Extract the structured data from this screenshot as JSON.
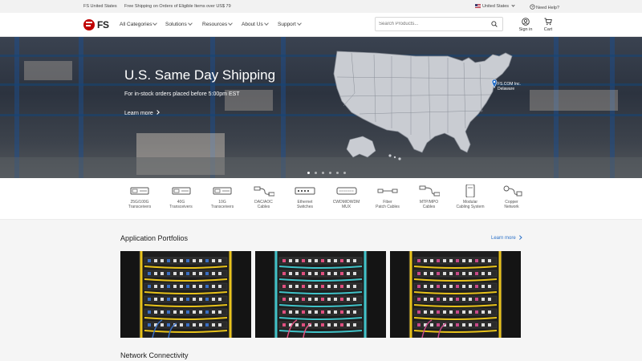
{
  "topbar": {
    "site": "FS United States",
    "promo": "Free Shipping on Orders of Eligible Items over US$ 79",
    "region": "United States",
    "help": "Need Help?"
  },
  "header": {
    "logo_text": "FS",
    "nav": [
      "All Categories",
      "Solutions",
      "Resources",
      "About Us",
      "Support"
    ],
    "search_placeholder": "Search Products...",
    "sign_in": "Sign in",
    "cart": "Cart"
  },
  "hero": {
    "title": "U.S. Same Day Shipping",
    "subtitle": "For in-stock orders placed before 5:00pm EST",
    "link": "Learn more",
    "pin_name": "FS.COM Inc.",
    "pin_place": "Delaware",
    "slides": 6,
    "active_slide": 0
  },
  "categories": [
    {
      "label": "25G/100G\nTransceivers",
      "icon": "transceiver-icon"
    },
    {
      "label": "40G\nTransceivers",
      "icon": "transceiver-icon"
    },
    {
      "label": "10G\nTransceivers",
      "icon": "transceiver-icon"
    },
    {
      "label": "DAC/AOC\nCables",
      "icon": "dac-cable-icon"
    },
    {
      "label": "Ethernet\nSwitches",
      "icon": "switch-icon"
    },
    {
      "label": "CWDM/DWDM\nMUX",
      "icon": "mux-icon"
    },
    {
      "label": "Fiber\nPatch Cables",
      "icon": "patch-cable-icon"
    },
    {
      "label": "MTP/MPO\nCables",
      "icon": "mtp-cable-icon"
    },
    {
      "label": "Modular\nCabling System",
      "icon": "modular-enclosure-icon"
    },
    {
      "label": "Copper\nNetwork",
      "icon": "copper-cable-icon"
    }
  ],
  "portfolios": {
    "title": "Application Portfolios",
    "learn_more": "Learn more",
    "items": [
      {
        "cable_color": "#e8c21a",
        "accent": "#3a6fc4"
      },
      {
        "cable_color": "#40c2c8",
        "accent": "#e05080"
      },
      {
        "cable_color": "#e8c21a",
        "accent": "#c84a8a"
      }
    ]
  },
  "next_section": {
    "title": "Network Connectivity"
  },
  "colors": {
    "brand_red": "#c00000",
    "link_blue": "#2a70c8"
  }
}
